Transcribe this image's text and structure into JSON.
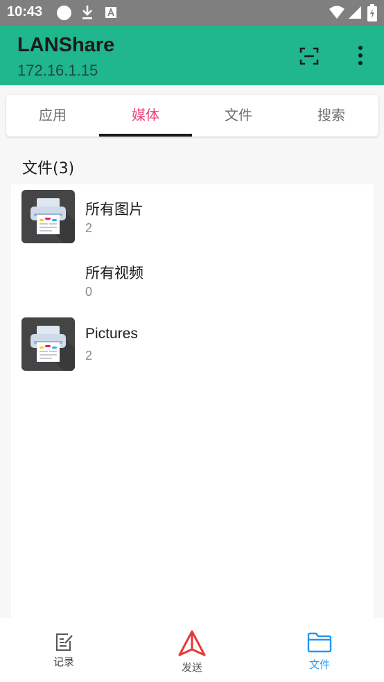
{
  "status_bar": {
    "time": "10:43",
    "icons": [
      "circle-icon",
      "download-icon",
      "a-icon",
      "wifi-icon",
      "signal-icon",
      "battery-icon"
    ]
  },
  "app_bar": {
    "title": "LANShare",
    "subtitle": "172.16.1.15",
    "background": "#20b68e",
    "actions": [
      "scan-icon",
      "more-vert-icon"
    ]
  },
  "tabs": {
    "items": [
      "应用",
      "媒体",
      "文件",
      "搜索"
    ],
    "selected": "媒体",
    "accent": "#e8407d"
  },
  "section": {
    "title": "文件(3)"
  },
  "items": [
    {
      "name": "所有图片",
      "count": "2",
      "has_thumbnail": true
    },
    {
      "name": "所有视频",
      "count": "0",
      "has_thumbnail": false
    },
    {
      "name": "Pictures",
      "count": "2",
      "has_thumbnail": true
    }
  ],
  "bottom_nav": {
    "items": [
      "记录",
      "发送",
      "文件"
    ],
    "selected": "文件",
    "selected_color": "#2196f3",
    "send_color": "#e53935"
  }
}
